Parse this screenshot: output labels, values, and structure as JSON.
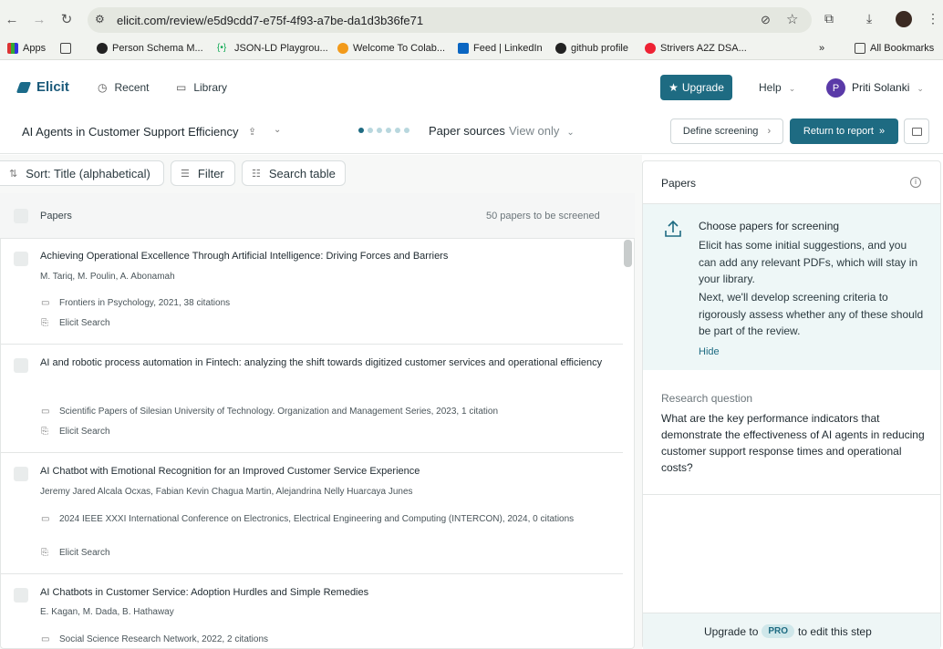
{
  "browser": {
    "url": "elicit.com/review/e5d9cdd7-e75f-4f93-a7be-da1d3b36fe71",
    "bookmarks": [
      {
        "label": "Apps"
      },
      {
        "label": "Person Schema M..."
      },
      {
        "label": "JSON-LD Playgrou..."
      },
      {
        "label": "Welcome To Colab..."
      },
      {
        "label": "Feed | LinkedIn"
      },
      {
        "label": "github profile"
      },
      {
        "label": "Strivers A2Z DSA..."
      }
    ],
    "more": "»",
    "all_bookmarks": "All Bookmarks"
  },
  "app": {
    "brand": "Elicit",
    "nav": {
      "recent": "Recent",
      "library": "Library"
    },
    "upgrade": "Upgrade",
    "help": "Help",
    "user_initial": "P",
    "user_name": "Priti Solanki"
  },
  "review": {
    "title": "AI Agents in Customer Support Efficiency",
    "step_label": "Paper sources",
    "view_mode": "View only",
    "define_screening": "Define screening",
    "return_to_report": "Return to report"
  },
  "controls": {
    "sort": "Sort: Title (alphabetical)",
    "filter": "Filter",
    "search_table": "Search table"
  },
  "table": {
    "header": "Papers",
    "count": "50 papers to be screened",
    "rows": [
      {
        "title": "Achieving Operational Excellence Through Artificial Intelligence: Driving Forces and Barriers",
        "authors": "M. Tariq, M. Poulin, A. Abonamah",
        "journal": "Frontiers in Psychology, 2021, 38 citations",
        "source": "Elicit Search"
      },
      {
        "title": "AI and robotic process automation in Fintech: analyzing the shift towards digitized customer services and operational efficiency",
        "authors": "",
        "journal": "Scientific Papers of Silesian University of Technology. Organization and Management Series, 2023, 1 citation",
        "source": "Elicit Search"
      },
      {
        "title": "AI Chatbot with Emotional Recognition for an Improved Customer Service Experience",
        "authors": "Jeremy Jared Alcala Ocxas, Fabian Kevin Chagua Martin, Alejandrina Nelly Huarcaya Junes",
        "journal": "2024 IEEE XXXI International Conference on Electronics, Electrical Engineering and Computing (INTERCON), 2024, 0 citations",
        "source": "Elicit Search"
      },
      {
        "title": "AI Chatbots in Customer Service: Adoption Hurdles and Simple Remedies",
        "authors": "E. Kagan, M. Dada, B. Hathaway",
        "journal": "Social Science Research Network, 2022, 2 citations",
        "source": ""
      }
    ]
  },
  "panel": {
    "title": "Papers",
    "suggest_title": "Choose papers for screening",
    "suggest_p1": "Elicit has some initial suggestions, and you can add any relevant PDFs, which will stay in your library.",
    "suggest_p2": "Next, we'll develop screening criteria to rigorously assess whether any of these should be part of the review.",
    "hide": "Hide",
    "rq_label": "Research question",
    "rq_text": "What are the key performance indicators that demonstrate the effectiveness of AI agents in reducing customer support response times and operational costs?",
    "footer_pre": "Upgrade to",
    "footer_badge": "PRO",
    "footer_post": "to edit this step"
  },
  "colors": {
    "accent": "#1e6b82",
    "panel_bg": "#eef7f7"
  }
}
